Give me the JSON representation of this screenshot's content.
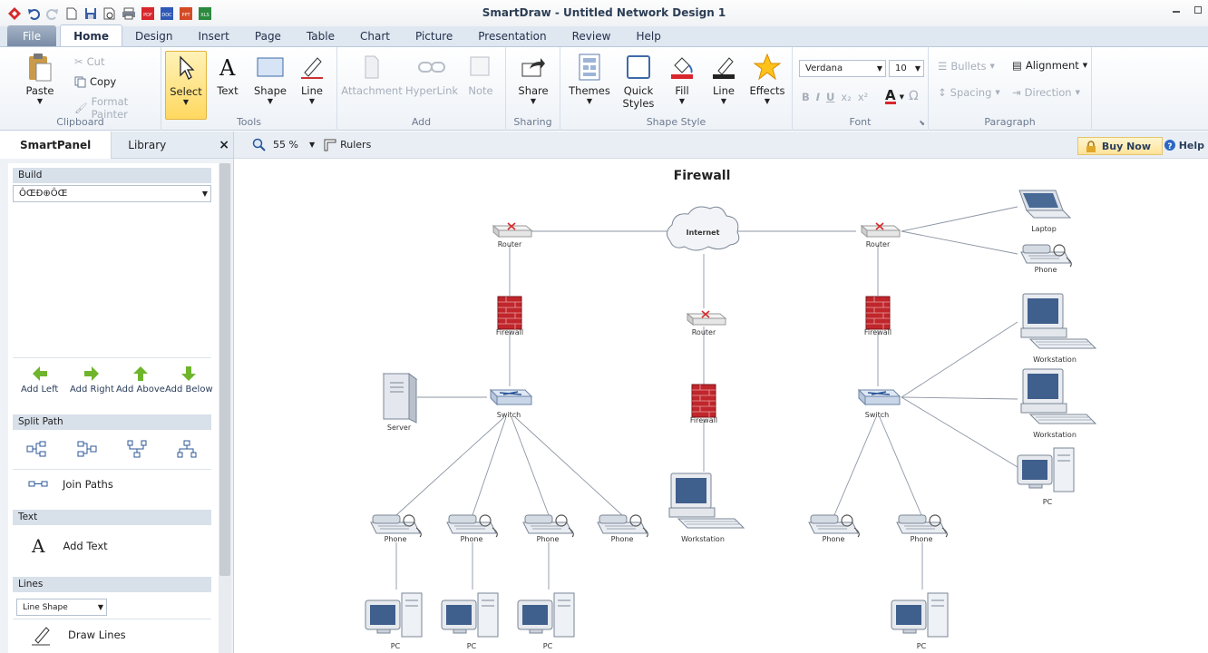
{
  "window": {
    "title": "SmartDraw - Untitled Network Design 1"
  },
  "quick_access": {
    "icons": [
      "app-logo-icon",
      "undo-icon",
      "redo-icon",
      "new-icon",
      "save-icon",
      "print-preview-icon",
      "print-icon",
      "pdf-icon",
      "doc-icon",
      "ppt-icon",
      "xls-icon"
    ],
    "file_badges": {
      "pdf": "PDF",
      "doc": "DOC",
      "ppt": "PPT",
      "xls": "XLS"
    }
  },
  "tabs": [
    "File",
    "Home",
    "Design",
    "Insert",
    "Page",
    "Table",
    "Chart",
    "Picture",
    "Presentation",
    "Review",
    "Help"
  ],
  "ribbon": {
    "clipboard": {
      "paste": "Paste",
      "cut": "Cut",
      "copy": "Copy",
      "format_painter": "Format Painter",
      "label": "Clipboard"
    },
    "tools": {
      "select": "Select",
      "text": "Text",
      "shape": "Shape",
      "line": "Line",
      "label": "Tools"
    },
    "add": {
      "attachment": "Attachment",
      "hyperlink": "HyperLink",
      "note": "Note",
      "label": "Add"
    },
    "sharing": {
      "share": "Share",
      "label": "Sharing"
    },
    "shape_style": {
      "themes": "Themes",
      "quick_styles": "Quick Styles",
      "fill": "Fill",
      "line": "Line",
      "effects": "Effects",
      "label": "Shape Style"
    },
    "font": {
      "family": "Verdana",
      "size": "10",
      "bold": "B",
      "italic": "I",
      "underline": "U",
      "subscript": "x₂",
      "superscript": "x²",
      "color": "A",
      "symbol": "Ω",
      "label": "Font"
    },
    "paragraph": {
      "bullets": "Bullets",
      "alignment": "Alignment",
      "spacing": "Spacing",
      "direction": "Direction",
      "label": "Paragraph"
    }
  },
  "left_panel": {
    "tabs": [
      "SmartPanel",
      "Library"
    ],
    "close": "×",
    "build": {
      "header": "Build",
      "value": "ÔŒÐ⊕ÔŒ"
    },
    "add_buttons": [
      "Add Left",
      "Add Right",
      "Add Above",
      "Add Below"
    ],
    "split_path": {
      "header": "Split Path",
      "join": "Join Paths"
    },
    "text": {
      "header": "Text",
      "add_text": "Add Text"
    },
    "lines": {
      "header": "Lines",
      "shape": "Line Shape",
      "draw": "Draw Lines"
    }
  },
  "canvas_bar": {
    "zoom": "55 %",
    "rulers": "Rulers",
    "buy_now": "Buy Now",
    "help": "Help"
  },
  "diagram": {
    "title": "Firewall",
    "labels": {
      "router": "Router",
      "firewall": "Firewall",
      "switch": "Switch",
      "server": "Server",
      "internet": "Internet",
      "laptop": "Laptop",
      "phone": "Phone",
      "workstation": "Workstation",
      "pc": "PC"
    }
  },
  "colors": {
    "accent": "#2b5797",
    "ribbon_select": "#ffd860",
    "firewall": "#c0262b",
    "buy_now": "#ffe9a8"
  }
}
